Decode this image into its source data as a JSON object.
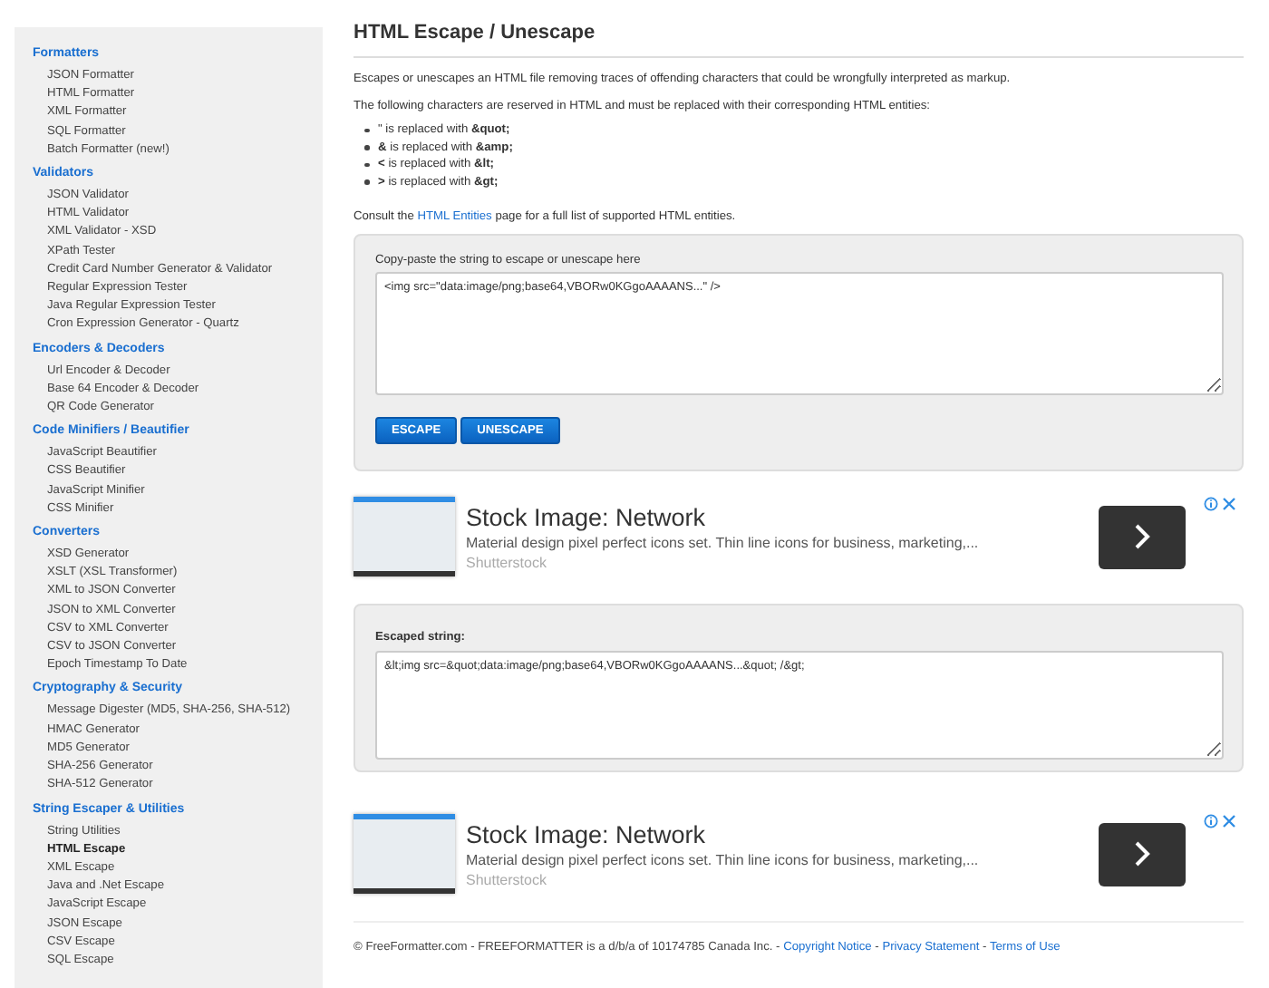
{
  "sidebar": {
    "sections": [
      {
        "title": "Formatters",
        "items": [
          {
            "label": "JSON Formatter",
            "selected": false
          },
          {
            "label": "HTML Formatter",
            "selected": false
          },
          {
            "label": "XML Formatter",
            "selected": false
          },
          {
            "label": "SQL Formatter",
            "selected": false
          },
          {
            "label": "Batch Formatter (new!)",
            "selected": false
          }
        ]
      },
      {
        "title": "Validators",
        "items": [
          {
            "label": "JSON Validator",
            "selected": false
          },
          {
            "label": "HTML Validator",
            "selected": false
          },
          {
            "label": "XML Validator - XSD",
            "selected": false
          },
          {
            "label": "XPath Tester",
            "selected": false
          },
          {
            "label": "Credit Card Number Generator & Validator",
            "selected": false
          },
          {
            "label": "Regular Expression Tester",
            "selected": false
          },
          {
            "label": "Java Regular Expression Tester",
            "selected": false
          },
          {
            "label": "Cron Expression Generator - Quartz",
            "selected": false
          }
        ]
      },
      {
        "title": "Encoders & Decoders",
        "items": [
          {
            "label": "Url Encoder & Decoder",
            "selected": false
          },
          {
            "label": "Base 64 Encoder & Decoder",
            "selected": false
          },
          {
            "label": "QR Code Generator",
            "selected": false
          }
        ]
      },
      {
        "title": "Code Minifiers / Beautifier",
        "items": [
          {
            "label": "JavaScript Beautifier",
            "selected": false
          },
          {
            "label": "CSS Beautifier",
            "selected": false
          },
          {
            "label": "JavaScript Minifier",
            "selected": false
          },
          {
            "label": "CSS Minifier",
            "selected": false
          }
        ]
      },
      {
        "title": "Converters",
        "items": [
          {
            "label": "XSD Generator",
            "selected": false
          },
          {
            "label": "XSLT (XSL Transformer)",
            "selected": false
          },
          {
            "label": "XML to JSON Converter",
            "selected": false
          },
          {
            "label": "JSON to XML Converter",
            "selected": false
          },
          {
            "label": "CSV to XML Converter",
            "selected": false
          },
          {
            "label": "CSV to JSON Converter",
            "selected": false
          },
          {
            "label": "Epoch Timestamp To Date",
            "selected": false
          }
        ]
      },
      {
        "title": "Cryptography & Security",
        "items": [
          {
            "label": "Message Digester (MD5, SHA-256, SHA-512)",
            "selected": false
          },
          {
            "label": "HMAC Generator",
            "selected": false
          },
          {
            "label": "MD5 Generator",
            "selected": false
          },
          {
            "label": "SHA-256 Generator",
            "selected": false
          },
          {
            "label": "SHA-512 Generator",
            "selected": false
          }
        ]
      },
      {
        "title": "String Escaper & Utilities",
        "items": [
          {
            "label": "String Utilities",
            "selected": false
          },
          {
            "label": "HTML Escape",
            "selected": true
          },
          {
            "label": "XML Escape",
            "selected": false
          },
          {
            "label": "Java and .Net Escape",
            "selected": false
          },
          {
            "label": "JavaScript Escape",
            "selected": false
          },
          {
            "label": "JSON Escape",
            "selected": false
          },
          {
            "label": "CSV Escape",
            "selected": false
          },
          {
            "label": "SQL Escape",
            "selected": false
          }
        ]
      }
    ]
  },
  "page": {
    "title": "HTML Escape / Unescape",
    "intro": "Escapes or unescapes an HTML file removing traces of offending characters that could be wrongfully interpreted as markup.",
    "reserved_note": "The following characters are reserved in HTML and must be replaced with their corresponding HTML entities:",
    "rules": [
      "\" is replaced with **&quot;**",
      "**&** is replaced with **&amp;**",
      "**<** is replaced with **&lt;**",
      "**>** is replaced with **&gt;**"
    ],
    "consult": [
      {
        "kind": "text",
        "text": "Consult the "
      },
      {
        "kind": "link",
        "text": "HTML Entities"
      },
      {
        "kind": "text",
        "text": " page for a full list of supported HTML entities."
      }
    ]
  },
  "input_panel": {
    "label": "Copy-paste the string to escape or unescape here",
    "value": "<img src=\"data:image/png;base64,VBORw0KGgoAAAANS...\" />",
    "buttons": [
      "ESCAPE",
      "UNESCAPE"
    ]
  },
  "ads": [
    {
      "title": "Stock Image: Network",
      "description": "Material design pixel perfect icons set. Thin line icons for business, marketing,...",
      "source": "Shutterstock"
    }
  ],
  "output_panel": {
    "label": "Escaped string:",
    "value": "&lt;img src=&quot;data:image/png;base64,VBORw0KGgoAAAANS...&quot; /&gt;"
  },
  "ads_bottom": [
    {
      "title": "Stock Image: Network",
      "description": "Material design pixel perfect icons set. Thin line icons for business, marketing,...",
      "source": "Shutterstock"
    }
  ],
  "footer": [
    {
      "kind": "text",
      "text": "© FreeFormatter.com - FREEFORMATTER is a d/b/a of 10174785 Canada Inc. - "
    },
    {
      "kind": "link",
      "text": "Copyright Notice"
    },
    {
      "kind": "text",
      "text": " - "
    },
    {
      "kind": "link",
      "text": "Privacy Statement"
    },
    {
      "kind": "text",
      "text": " - "
    },
    {
      "kind": "link",
      "text": "Terms of Use"
    }
  ]
}
